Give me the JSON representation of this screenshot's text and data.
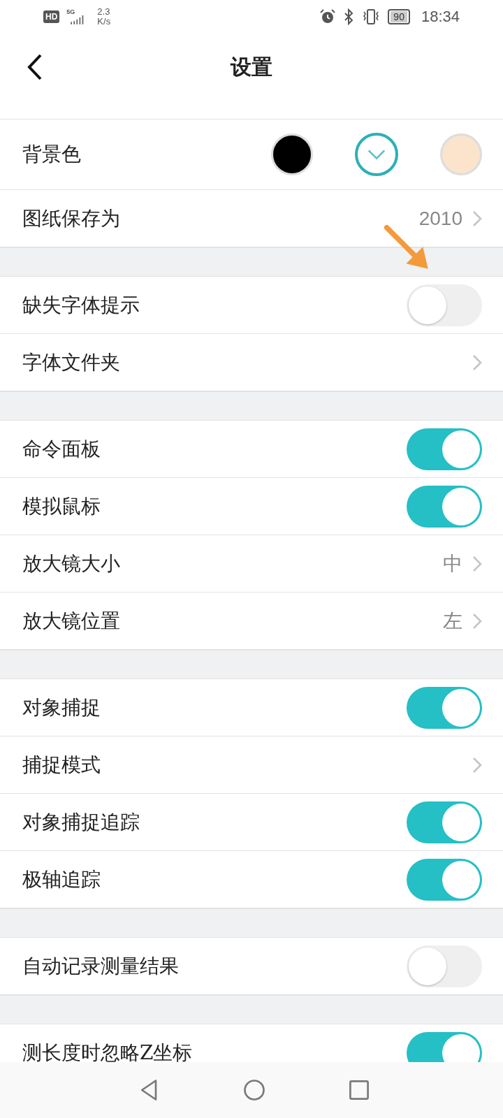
{
  "status_bar": {
    "hd": "HD",
    "network": "5G",
    "speed_value": "2.3",
    "speed_unit": "K/s",
    "battery": "90",
    "time": "18:34"
  },
  "header": {
    "title": "设置"
  },
  "groups": [
    [
      {
        "kind": "swatches",
        "label": "背景色",
        "swatches": [
          {
            "color": "#000000",
            "selected": false
          },
          {
            "color": "#ffffff",
            "selected": true
          },
          {
            "color": "#fbe3cc",
            "selected": false
          }
        ]
      },
      {
        "kind": "link",
        "label": "图纸保存为",
        "value": "2010"
      }
    ],
    [
      {
        "kind": "toggle",
        "label": "缺失字体提示",
        "on": false
      },
      {
        "kind": "link",
        "label": "字体文件夹"
      }
    ],
    [
      {
        "kind": "toggle",
        "label": "命令面板",
        "on": true
      },
      {
        "kind": "toggle",
        "label": "模拟鼠标",
        "on": true
      },
      {
        "kind": "link",
        "label": "放大镜大小",
        "value": "中"
      },
      {
        "kind": "link",
        "label": "放大镜位置",
        "value": "左"
      }
    ],
    [
      {
        "kind": "toggle",
        "label": "对象捕捉",
        "on": true
      },
      {
        "kind": "link",
        "label": "捕捉模式"
      },
      {
        "kind": "toggle",
        "label": "对象捕捉追踪",
        "on": true
      },
      {
        "kind": "toggle",
        "label": "极轴追踪",
        "on": true
      }
    ],
    [
      {
        "kind": "toggle",
        "label": "自动记录测量结果",
        "on": false
      }
    ],
    [
      {
        "kind": "toggle",
        "label": "测长度时忽略Z坐标",
        "on": true
      }
    ]
  ]
}
